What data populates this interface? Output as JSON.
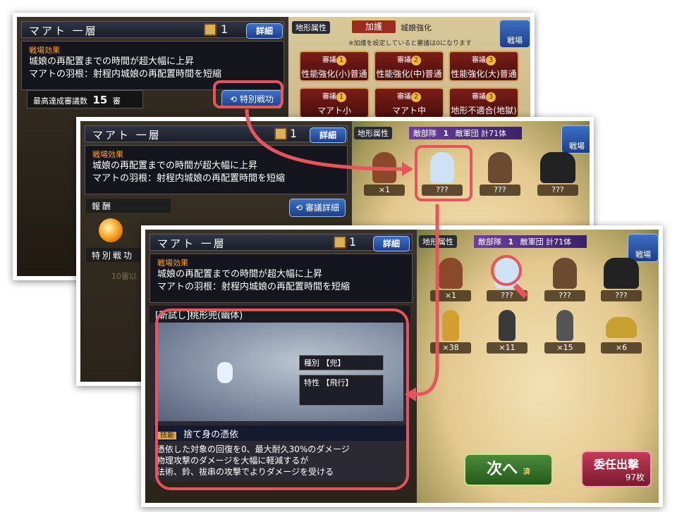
{
  "screen1": {
    "title": "マアト 一層",
    "scroll_count": "1",
    "detail_button": "詳細",
    "effects_title": "戦場効果",
    "effects": [
      "城娘の再配置までの時間が超大幅に上昇",
      "マアトの羽根：射程内城娘の再配置時間を短縮"
    ],
    "best_label": "最高達成審議数",
    "best_value": "15",
    "best_unit": "審",
    "special_button": "特別戦功",
    "terrain_label": "地形属性",
    "kago_label": "加護",
    "kago_value": "城娘強化",
    "note": "※加護を設定していると審議は0になります",
    "battlefield_button": "戦場",
    "sengi_label": "審議",
    "sengi": [
      {
        "num": "1",
        "text": "性能強化(小)普通"
      },
      {
        "num": "2",
        "text": "性能強化(中)普通"
      },
      {
        "num": "3",
        "text": "性能強化(大)普通"
      },
      {
        "num": "1",
        "text": "マアト小"
      },
      {
        "num": "2",
        "text": "マアト中"
      },
      {
        "num": "3",
        "text": "地形不適合(地獄)"
      }
    ]
  },
  "screen2": {
    "title": "マアト 一層",
    "scroll_count": "1",
    "detail_button": "詳細",
    "effects_title": "戦場効果",
    "effects": [
      "城娘の再配置までの時間が超大幅に上昇",
      "マアトの羽根：射程内城娘の再配置時間を短縮"
    ],
    "reward_label": "報酬",
    "special_label": "特別戦功",
    "sengi_detail_button": "審議詳細",
    "terrain_label": "地形属性",
    "enemy_label": "敵部隊",
    "enemy_num": "1",
    "enemy_summary": "敵軍団 計71体",
    "battlefield_button": "戦場",
    "enemies": [
      "×1",
      "???",
      "???",
      "???"
    ],
    "faded_text": "10審以"
  },
  "screen3": {
    "title": "マアト 一層",
    "scroll_count": "1",
    "detail_button": "詳細",
    "effects_title": "戦場効果",
    "effects": [
      "城娘の再配置までの時間が超大幅に上昇",
      "マアトの羽根：射程内城娘の再配置時間を短縮"
    ],
    "terrain_label": "地形属性",
    "enemy_label": "敵部隊",
    "enemy_num": "1",
    "enemy_summary": "敵軍団 計71体",
    "battlefield_button": "戦場",
    "enemies_row1": [
      "×1",
      "???",
      "???",
      "???"
    ],
    "enemies_row2": [
      "×38",
      "×11",
      "×15",
      "×6"
    ],
    "unit_name": "[斬試し]桃形兜(幽体)",
    "type_label": "種別",
    "type_value": "【兜】",
    "trait_label": "特性",
    "trait_value": "【飛行】",
    "skill_tag": "技能",
    "skill_name": "捨て身の憑依",
    "skill_lines": [
      "憑依した対象の回復を0、最大耐久30%のダメージ",
      "物理攻撃のダメージを大幅に軽減するが",
      "法術、鈴、祓串の攻撃でよりダメージを受ける"
    ],
    "next_button": "次へ",
    "next_mark": "済",
    "auto_button": "委任出撃",
    "auto_count": "97枚"
  },
  "colors": {
    "highlight": "#e9545c",
    "blue_button": "#2a55a8",
    "purple_bar": "#5a3390"
  }
}
